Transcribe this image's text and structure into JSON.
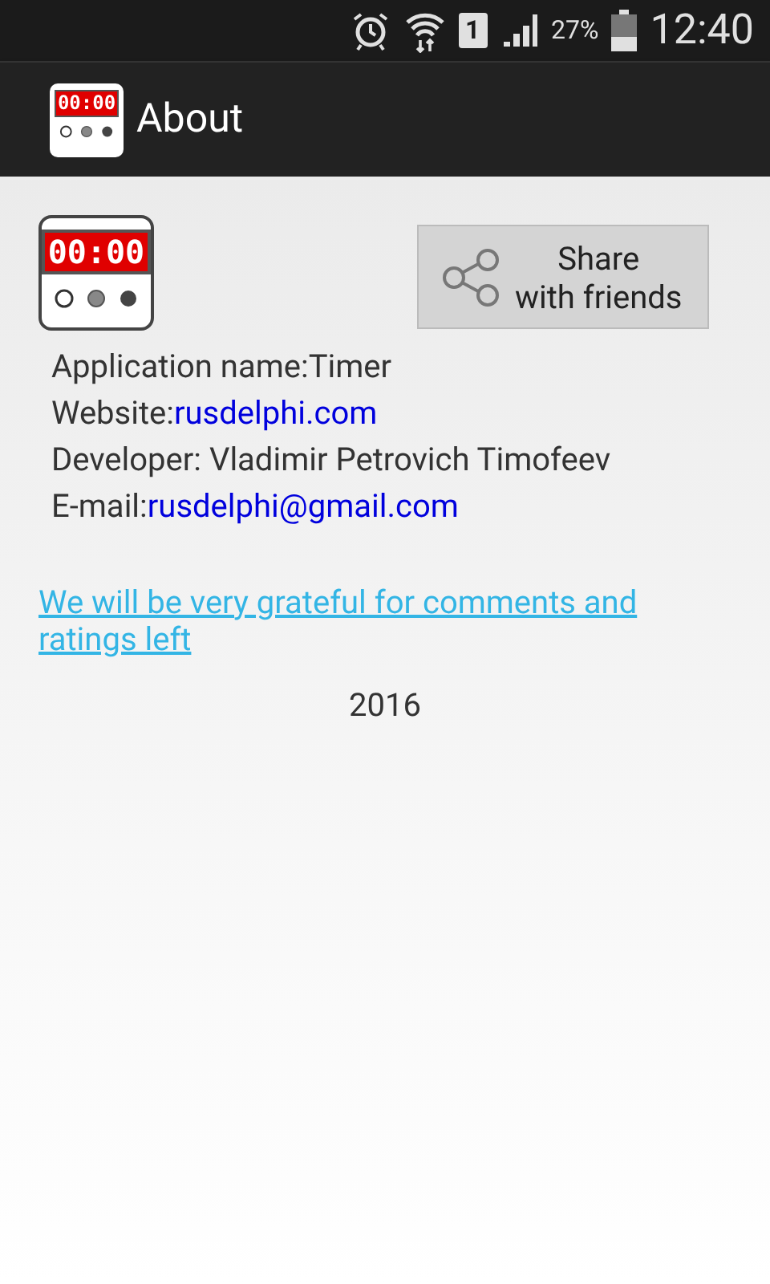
{
  "status_bar": {
    "sim": "1",
    "battery_text": "27%",
    "time": "12:40"
  },
  "app_bar": {
    "logo_display": "00:00",
    "title": "About"
  },
  "app_icon": {
    "display": "00:00"
  },
  "share_button": {
    "label_line_1": "Share",
    "label_line_2": "with friends"
  },
  "info": [
    {
      "kind": "text",
      "text": "Application name:Timer"
    },
    {
      "kind": "link",
      "label": "Website:",
      "link": "rusdelphi.com"
    },
    {
      "kind": "text",
      "text": "Developer: Vladimir Petrovich Timofeev"
    },
    {
      "kind": "link",
      "label": "E-mail:",
      "link": "rusdelphi@gmail.com"
    }
  ],
  "rating_link": "We will be very grateful for comments and ratings left",
  "year": "2016"
}
